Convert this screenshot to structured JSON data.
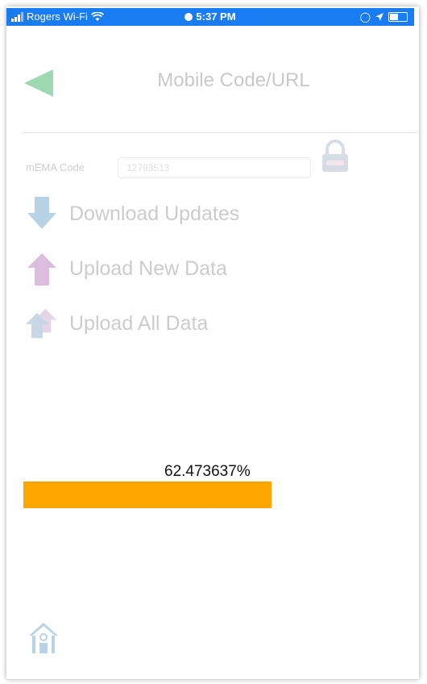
{
  "status_bar": {
    "carrier": "Rogers Wi-Fi",
    "time": "5:37 PM"
  },
  "header": {
    "title": "Mobile Code/URL",
    "back_icon": "back-arrow-icon"
  },
  "code": {
    "label": "mEMA Code",
    "value": "12793513",
    "lock_icon": "lock-icon"
  },
  "actions": [
    {
      "label": "Download Updates",
      "icon": "download-arrow-icon"
    },
    {
      "label": "Upload New Data",
      "icon": "upload-arrow-icon"
    },
    {
      "label": "Upload All Data",
      "icon": "upload-all-arrows-icon"
    }
  ],
  "progress": {
    "text": "62.473637%",
    "percent": 68.5
  },
  "colors": {
    "status_bar": "#1a7cf3",
    "progress": "#ffa500",
    "back_arrow": "#9ed9b2",
    "download": "#b9d3e6",
    "upload_new": "#dcbde0",
    "upload_all": "#c9d6e3"
  },
  "footer": {
    "home_icon": "home-icon"
  }
}
